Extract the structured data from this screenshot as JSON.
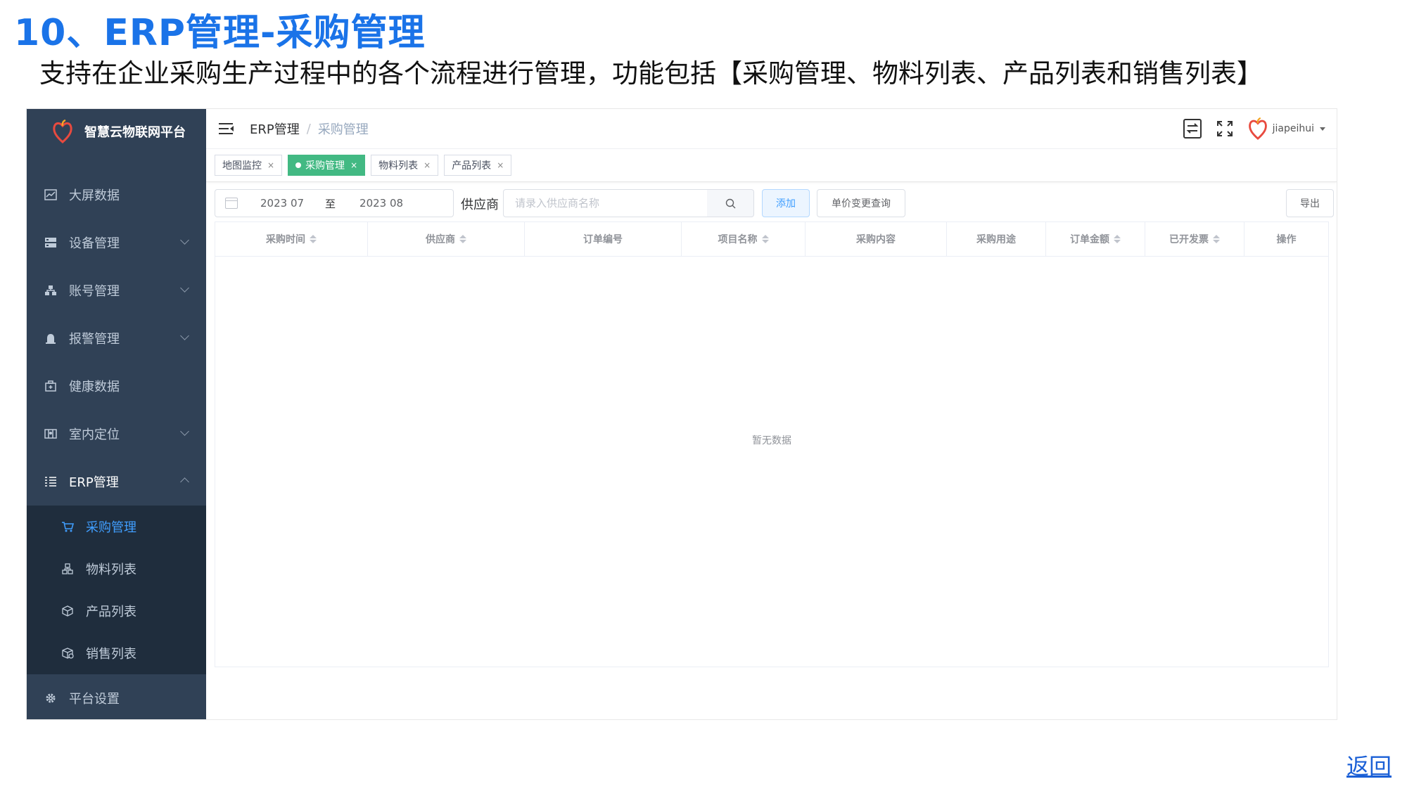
{
  "slide": {
    "title": "10、ERP管理-采购管理",
    "subtitle": "支持在企业采购生产过程中的各个流程进行管理，功能包括【采购管理、物料列表、产品列表和销售列表】",
    "back_link": "返回"
  },
  "sidebar": {
    "brand": "智慧云物联网平台",
    "items": [
      {
        "label": "大屏数据",
        "icon": "chart-icon"
      },
      {
        "label": "设备管理",
        "icon": "server-icon"
      },
      {
        "label": "账号管理",
        "icon": "org-icon"
      },
      {
        "label": "报警管理",
        "icon": "alarm-icon"
      },
      {
        "label": "健康数据",
        "icon": "health-icon"
      },
      {
        "label": "室内定位",
        "icon": "map-icon"
      },
      {
        "label": "ERP管理",
        "icon": "list-icon"
      },
      {
        "label": "平台设置",
        "icon": "gear-icon"
      }
    ],
    "erp_sub": [
      {
        "label": "采购管理",
        "icon": "cart-icon"
      },
      {
        "label": "物料列表",
        "icon": "component-icon"
      },
      {
        "label": "产品列表",
        "icon": "box-icon"
      },
      {
        "label": "销售列表",
        "icon": "package-icon"
      }
    ]
  },
  "navbar": {
    "breadcrumb": [
      "ERP管理",
      "采购管理"
    ],
    "separator": "/",
    "username": "jiapeihui"
  },
  "tags": [
    {
      "label": "地图监控",
      "close": "×"
    },
    {
      "label": "采购管理",
      "close": "×"
    },
    {
      "label": "物料列表",
      "close": "×"
    },
    {
      "label": "产品列表",
      "close": "×"
    }
  ],
  "filters": {
    "start_date": "2023  07",
    "range_separator": "至",
    "end_date": "2023  08",
    "supplier_label": "供应商",
    "supplier_placeholder": "请录入供应商名称",
    "add_label": "添加",
    "price_query_label": "单价变更查询",
    "export_label": "导出"
  },
  "table": {
    "columns": [
      "采购时间",
      "供应商",
      "订单编号",
      "项目名称",
      "采购内容",
      "采购用途",
      "订单金额",
      "已开发票",
      "操作"
    ],
    "empty_text": "暂无数据"
  },
  "colors": {
    "sidebar_bg": "#304156",
    "submenu_bg": "#1f2d3d",
    "active_tag": "#42b983",
    "accent": "#409eff",
    "title_blue": "#1a73e8"
  }
}
